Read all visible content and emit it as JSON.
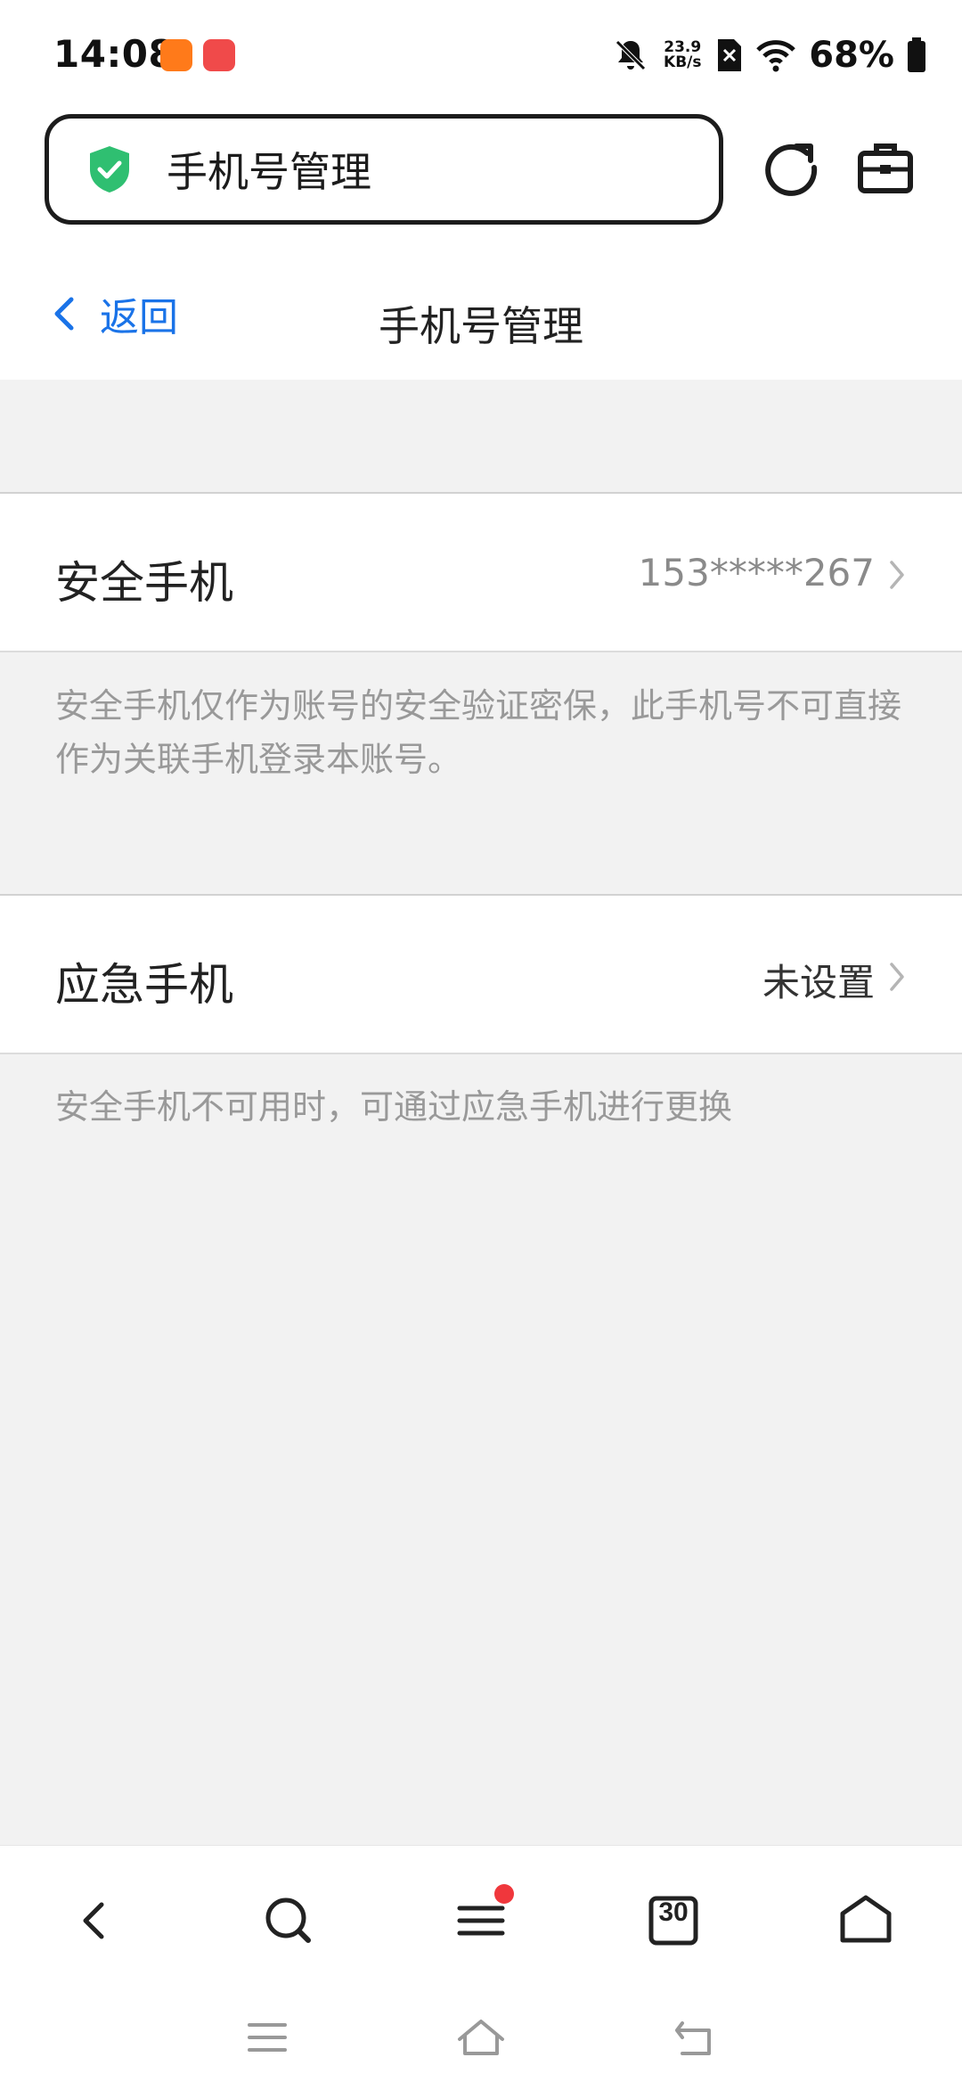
{
  "status_bar": {
    "time": "14:08",
    "network_speed_value": "23.9",
    "network_speed_unit": "KB/s",
    "battery_percent": "68%",
    "icons": [
      "app-orange-icon",
      "huawei-store-icon",
      "bell-muted-icon",
      "sim-none-icon",
      "wifi-icon",
      "battery-icon"
    ]
  },
  "url_bar": {
    "text": "手机号管理",
    "icons": [
      "shield-check-icon",
      "refresh-icon",
      "toolbox-icon"
    ]
  },
  "header": {
    "back_label": "返回",
    "title": "手机号管理"
  },
  "security_phone": {
    "label": "安全手机",
    "value": "153*****267",
    "note": "安全手机仅作为账号的安全验证密保，此手机号不可直接作为关联手机登录本账号。"
  },
  "emergency_phone": {
    "label": "应急手机",
    "value": "未设置",
    "note": "安全手机不可用时，可通过应急手机进行更换"
  },
  "bottom_nav": {
    "tabs_count": "30",
    "icons": [
      "back-icon",
      "search-icon",
      "menu-icon",
      "tabs-icon",
      "home-icon"
    ]
  },
  "colors": {
    "accent": "#1a73e8",
    "shield": "#2fbf71",
    "background": "#f2f2f2",
    "badge": "#f0373c"
  }
}
